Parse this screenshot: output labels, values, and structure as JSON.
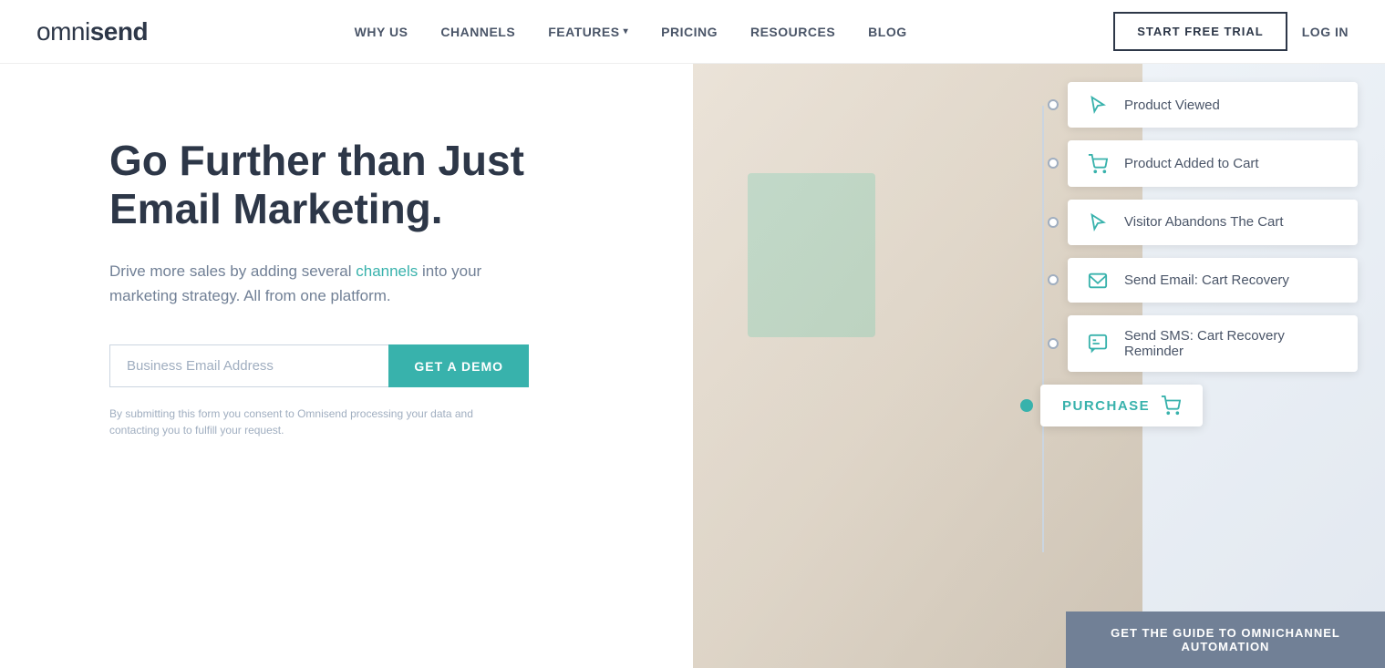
{
  "brand": {
    "name": "omnisend",
    "name_styled": "omni<strong>send</strong>"
  },
  "nav": {
    "items": [
      {
        "id": "why-us",
        "label": "WHY US"
      },
      {
        "id": "channels",
        "label": "CHANNELS"
      },
      {
        "id": "features",
        "label": "FEATURES",
        "hasChevron": true
      },
      {
        "id": "pricing",
        "label": "PRICING"
      },
      {
        "id": "resources",
        "label": "RESOURCES"
      },
      {
        "id": "blog",
        "label": "BLOG"
      }
    ],
    "cta_trial": "START FREE TRIAL",
    "cta_login": "LOG IN"
  },
  "hero": {
    "title": "Go Further than Just Email Marketing.",
    "subtitle_part1": "Drive more sales by adding several ",
    "subtitle_link": "channels",
    "subtitle_part2": " into your marketing strategy. All from one platform.",
    "email_placeholder": "Business Email Address",
    "cta_button": "GET A DEMO",
    "disclaimer": "By submitting this form you consent to Omnisend processing your data and contacting you to fulfill your request."
  },
  "workflow": {
    "items": [
      {
        "id": "product-viewed",
        "label": "Product Viewed",
        "icon": "cursor"
      },
      {
        "id": "product-added",
        "label": "Product Added to Cart",
        "icon": "cart"
      },
      {
        "id": "visitor-abandons",
        "label": "Visitor Abandons The Cart",
        "icon": "cursor"
      },
      {
        "id": "send-email",
        "label": "Send Email: Cart Recovery",
        "icon": "email"
      },
      {
        "id": "send-sms",
        "label": "Send SMS: Cart Recovery Reminder",
        "icon": "sms"
      }
    ],
    "purchase_label": "PURCHASE"
  },
  "bottom_cta": "GET THE GUIDE TO OMNICHANNEL AUTOMATION",
  "colors": {
    "brand_teal": "#38b2ac",
    "teal_light": "#81e6d9",
    "text_dark": "#2d3748",
    "text_mid": "#4a5568",
    "text_light": "#718096",
    "bg_white": "#ffffff",
    "border": "#cbd5e0"
  }
}
